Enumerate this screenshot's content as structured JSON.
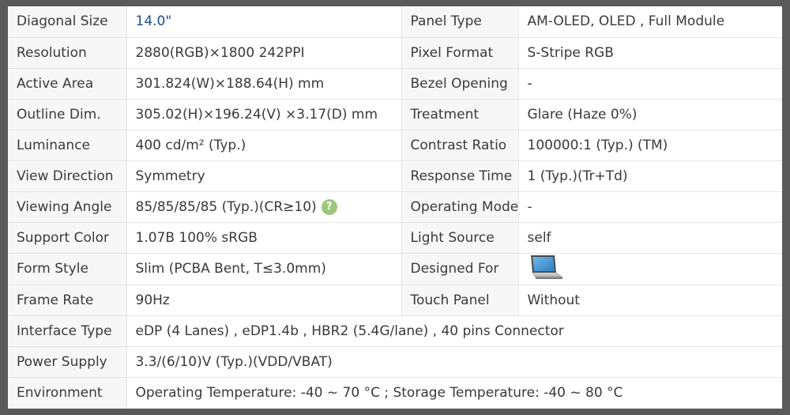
{
  "rows": [
    {
      "k1": "Diagonal Size",
      "v1": "14.0\"",
      "k2": "Panel Type",
      "v2": "AM-OLED, OLED , Full Module"
    },
    {
      "k1": "Resolution",
      "v1": "2880(RGB)×1800  242PPI",
      "k2": "Pixel Format",
      "v2": "S-Stripe RGB"
    },
    {
      "k1": "Active Area",
      "v1": "301.824(W)×188.64(H) mm",
      "k2": "Bezel Opening",
      "v2": "-"
    },
    {
      "k1": "Outline Dim.",
      "v1": "305.02(H)×196.24(V) ×3.17(D) mm",
      "k2": "Treatment",
      "v2": "Glare (Haze 0%)"
    },
    {
      "k1": "Luminance",
      "v1": "400 cd/m² (Typ.)",
      "k2": "Contrast Ratio",
      "v2": "100000:1 (Typ.) (TM)"
    },
    {
      "k1": "View Direction",
      "v1": "Symmetry",
      "k2": "Response Time",
      "v2": "1 (Typ.)(Tr+Td)"
    },
    {
      "k1": "Viewing Angle",
      "v1": "85/85/85/85 (Typ.)(CR≥10)",
      "k2": "Operating Mode",
      "v2": "-"
    },
    {
      "k1": "Support Color",
      "v1": "1.07B   100% sRGB",
      "k2": "Light Source",
      "v2": "self"
    },
    {
      "k1": "Form Style",
      "v1": "Slim (PCBA Bent, T≤3.0mm)",
      "k2": "Designed For",
      "v2": ""
    },
    {
      "k1": "Frame Rate",
      "v1": "90Hz",
      "k2": "Touch Panel",
      "v2": "Without"
    }
  ],
  "wide_rows": [
    {
      "k": "Interface Type",
      "v": "eDP (4 Lanes) , eDP1.4b , HBR2 (5.4G/lane) , 40 pins Connector"
    },
    {
      "k": "Power Supply",
      "v": "3.3/(6/10)V (Typ.)(VDD/VBAT)"
    },
    {
      "k": "Environment",
      "v": "Operating Temperature: -40 ~ 70 °C ; Storage Temperature: -40 ~ 80 °C"
    }
  ],
  "icons": {
    "help": "question-icon",
    "help_glyph": "?",
    "designed_for": "laptop-icon"
  },
  "colors": {
    "frame": "#5a5a5a",
    "key_bg": "#f7f7f7",
    "diagonal_value": "#1f4e8c",
    "help_icon": "#9cc77a"
  }
}
